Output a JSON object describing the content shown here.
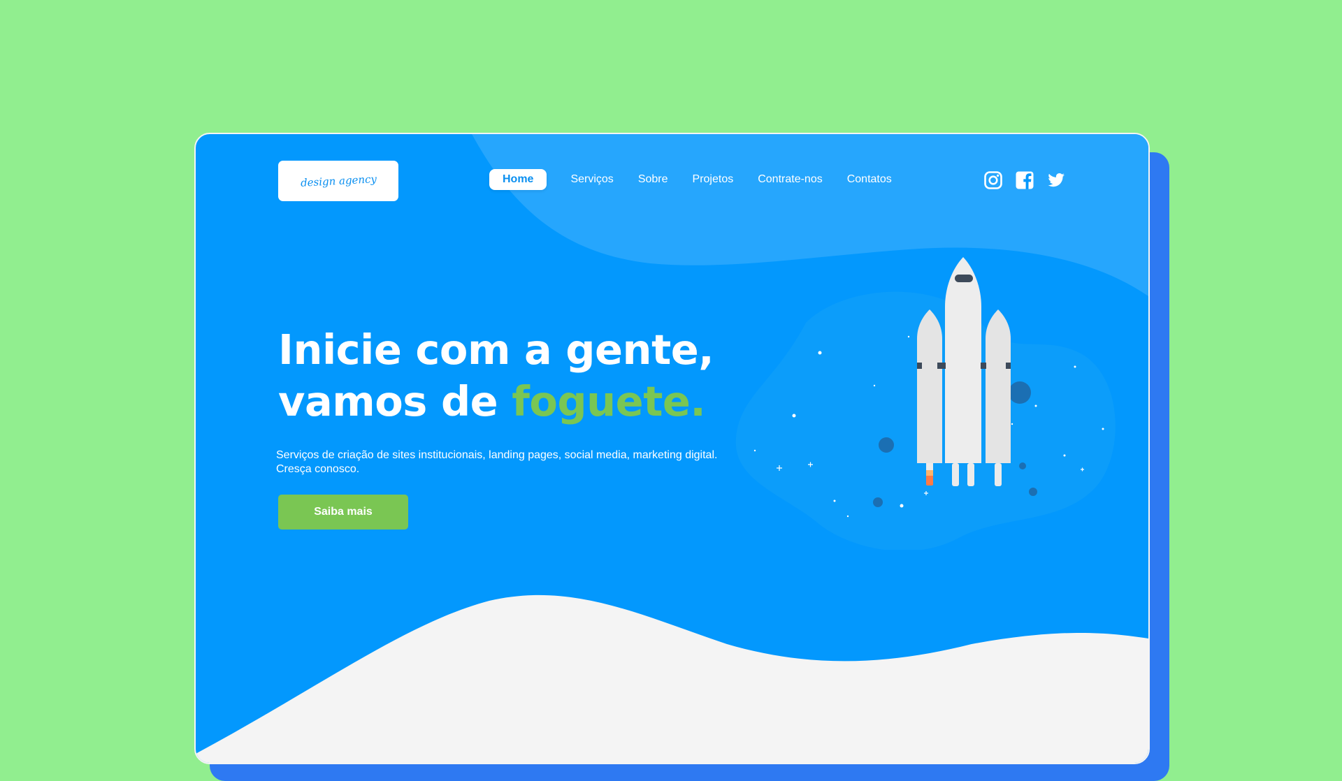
{
  "brand": {
    "logo_text": "design agency"
  },
  "nav": {
    "items": [
      {
        "label": "Home",
        "active": true
      },
      {
        "label": "Serviços",
        "active": false
      },
      {
        "label": "Sobre",
        "active": false
      },
      {
        "label": "Projetos",
        "active": false
      },
      {
        "label": "Contrate-nos",
        "active": false
      },
      {
        "label": "Contatos",
        "active": false
      }
    ]
  },
  "social": {
    "icons": [
      "instagram-icon",
      "facebook-icon",
      "twitter-icon"
    ]
  },
  "hero": {
    "title_line1": "Inicie com a gente,",
    "title_line2_prefix": "vamos de ",
    "title_line2_accent": "foguete.",
    "subtitle_line1": "Serviços de criação de sites institucionais, landing pages, social media, marketing digital.",
    "subtitle_line2": "Cresça conosco.",
    "cta_label": "Saiba mais"
  },
  "colors": {
    "background": "#91ee8f",
    "hero_blue": "#0398fd",
    "light_blue": "#26a6fd",
    "accent_green": "#7ac653",
    "side_card": "#2e79f2",
    "white": "#ffffff",
    "wave": "#f4f4f4"
  }
}
